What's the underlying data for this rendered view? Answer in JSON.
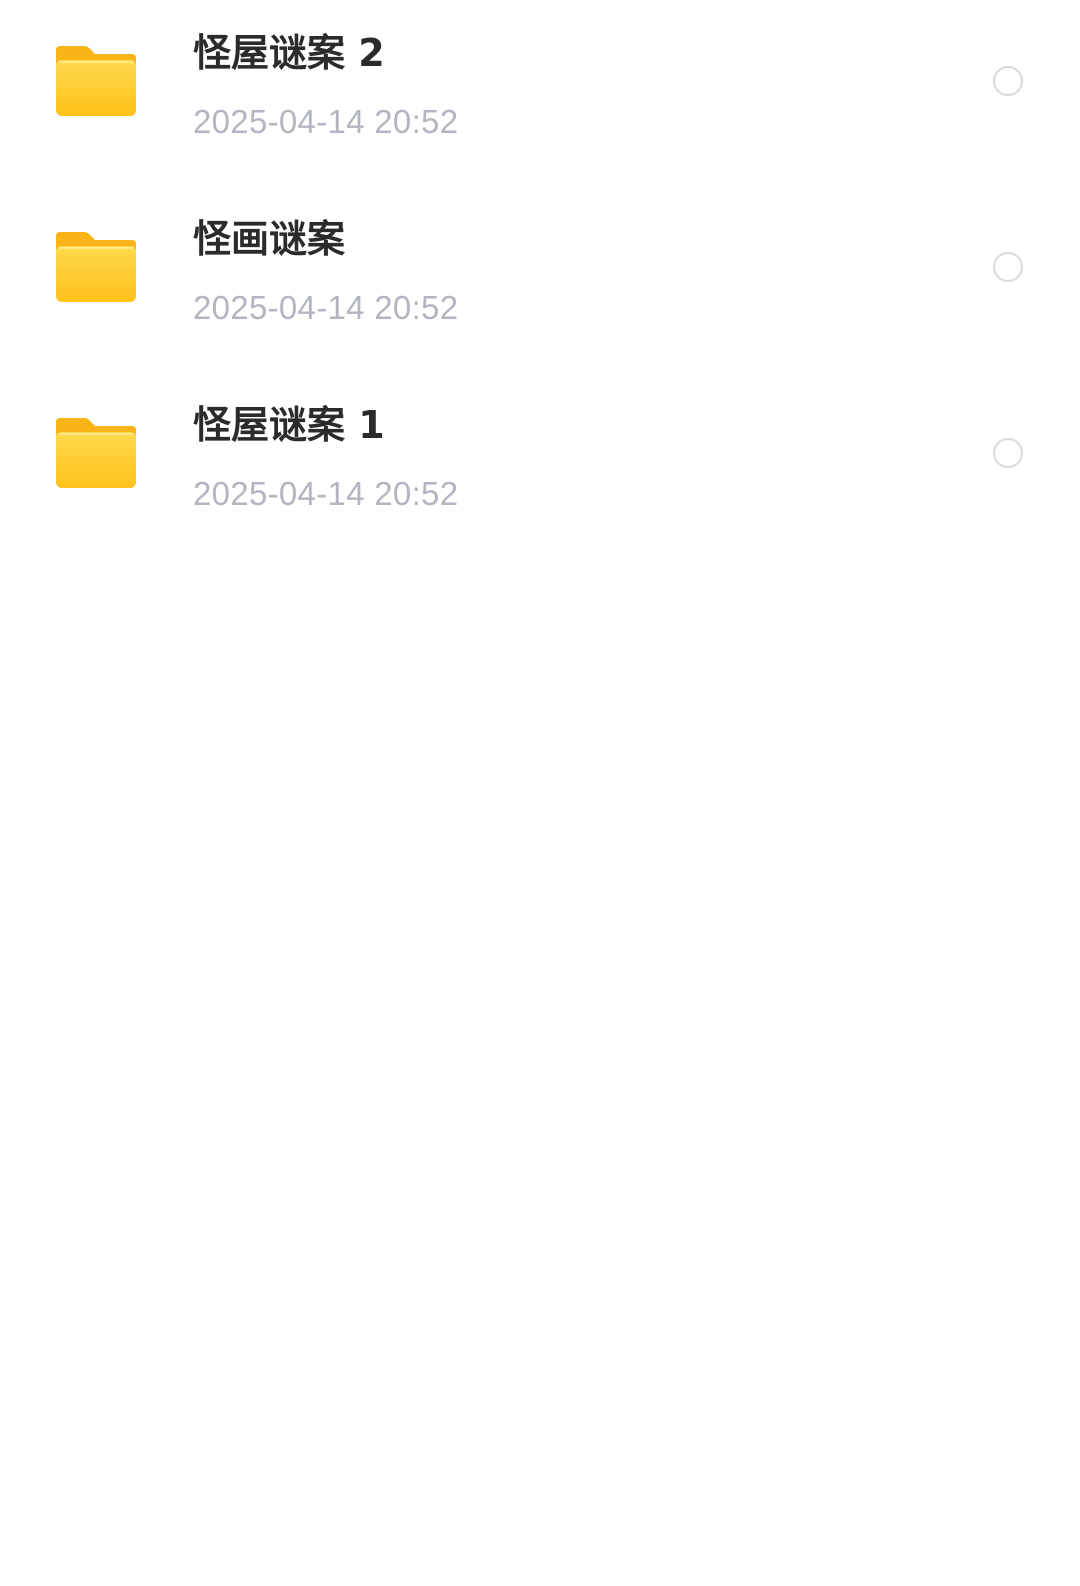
{
  "files": [
    {
      "name": "怪屋谜案 2",
      "date": "2025-04-14 20:52",
      "selected": false,
      "icon": "folder-icon"
    },
    {
      "name": "怪画谜案",
      "date": "2025-04-14 20:52",
      "selected": false,
      "icon": "folder-icon"
    },
    {
      "name": "怪屋谜案 1",
      "date": "2025-04-14 20:52",
      "selected": false,
      "icon": "folder-icon"
    }
  ],
  "colors": {
    "folder_primary": "#FFCC33",
    "folder_tab": "#F9B417",
    "name_text": "#2b2b2b",
    "date_text": "#b3b6c2",
    "checkbox_border": "#d9d9de",
    "background": "#ffffff"
  }
}
